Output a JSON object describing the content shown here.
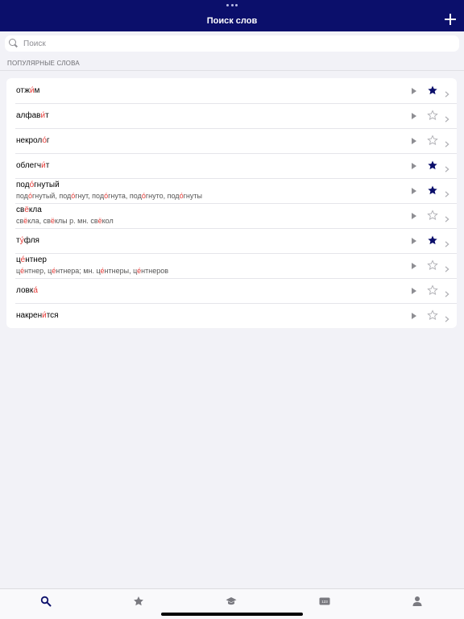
{
  "nav": {
    "title": "Поиск слов"
  },
  "search": {
    "placeholder": "Поиск"
  },
  "section": {
    "title": "ПОПУЛЯРНЫЕ СЛОВА"
  },
  "colors": {
    "nav_bg": "#0b0f6b",
    "stress": "#e53935",
    "star_active": "#0b0f6b",
    "inactive": "#8e8e93"
  },
  "words": [
    {
      "word": "отжи́м",
      "forms": "",
      "starred": true
    },
    {
      "word": "алфави́т",
      "forms": "",
      "starred": false
    },
    {
      "word": "некроло́г",
      "forms": "",
      "starred": false
    },
    {
      "word": "облегчи́т",
      "forms": "",
      "starred": true
    },
    {
      "word": "подо́гнутый",
      "forms": "подо́гнутый, подо́гнут, подо́гнута, подо́гнуто, подо́гнуты",
      "starred": true
    },
    {
      "word": "свёкла",
      "forms": "свёкла, свёклы р. мн. свёкол",
      "starred": false
    },
    {
      "word": "ту́фля",
      "forms": "",
      "starred": true
    },
    {
      "word": "це́нтнер",
      "forms": "це́нтнер, це́нтнера; мн. це́нтнеры, це́нтнеров",
      "starred": false
    },
    {
      "word": "ловка́",
      "forms": "",
      "starred": false
    },
    {
      "word": "накрени́тся",
      "forms": "",
      "starred": false
    }
  ],
  "tabs": [
    {
      "icon": "search-icon",
      "active": true
    },
    {
      "icon": "star-icon",
      "active": false
    },
    {
      "icon": "graduation-cap-icon",
      "active": false
    },
    {
      "icon": "numbers-icon",
      "active": false,
      "label": "123"
    },
    {
      "icon": "profile-icon",
      "active": false
    }
  ]
}
